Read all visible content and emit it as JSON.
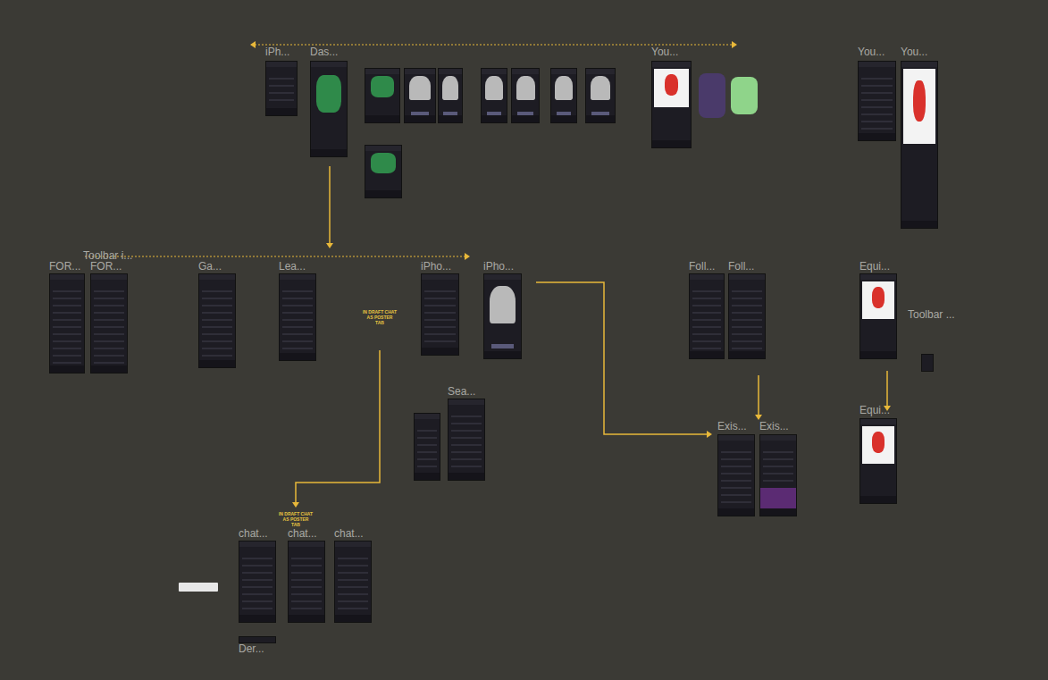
{
  "canvas": {
    "labels": [
      "iPh...",
      "Das...",
      "You...",
      "You...",
      "You...",
      "Toolbar i...",
      "FOR...",
      "FOR...",
      "Ga...",
      "Lea...",
      "iPho...",
      "iPho...",
      "Foll...",
      "Foll...",
      "Equi...",
      "Toolbar ...",
      "Sea...",
      "Exis...",
      "Exis...",
      "Equi...",
      "chat...",
      "chat...",
      "chat...",
      "Der..."
    ],
    "notes": [
      "IN DRAFT CHAT AS POSTER TAB",
      "IN DRAFT CHAT AS POSTER TAB"
    ]
  }
}
